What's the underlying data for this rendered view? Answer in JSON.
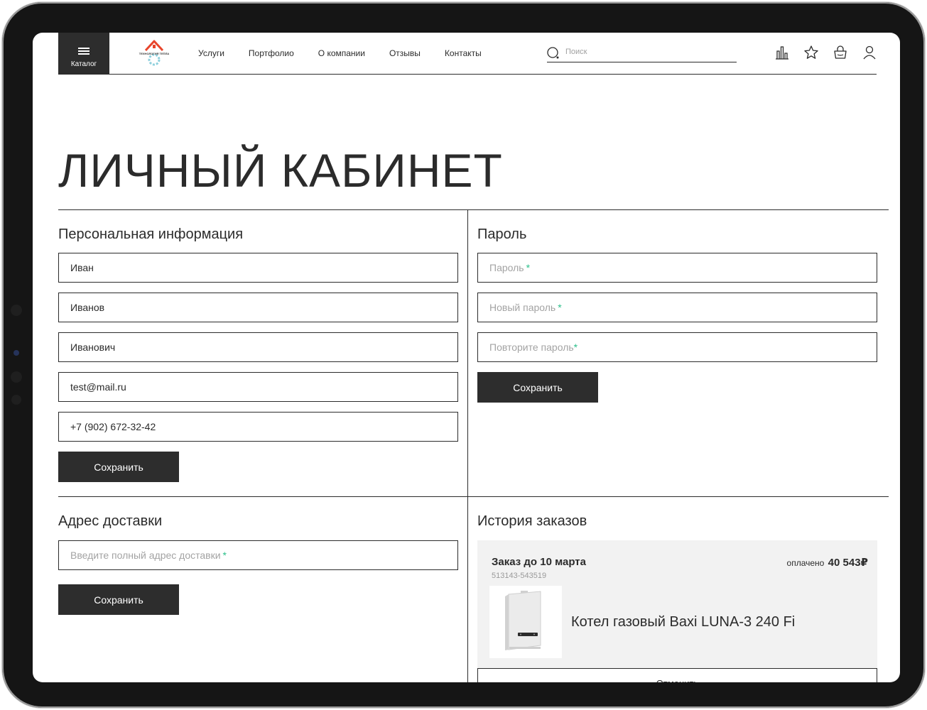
{
  "header": {
    "catalog_label": "Каталог",
    "logo_text": "ТЕХНОЛОГИЯ ТЕПЛА",
    "nav": [
      "Услуги",
      "Портфолио",
      "О компании",
      "Отзывы",
      "Контакты"
    ],
    "search_placeholder": "Поиск",
    "icons": [
      "compare-icon",
      "favorite-icon",
      "cart-icon",
      "user-icon"
    ]
  },
  "page_title": "ЛИЧНЫЙ КАБИНЕТ",
  "personal": {
    "title": "Персональная информация",
    "first_name": "Иван",
    "last_name": "Иванов",
    "middle_name": "Иванович",
    "email": "test@mail.ru",
    "phone": "+7 (902) 672-32-42",
    "save_label": "Сохранить"
  },
  "password": {
    "title": "Пароль",
    "current_placeholder": "Пароль",
    "new_placeholder": "Новый пароль",
    "repeat_placeholder": "Повторите пароль",
    "required_mark": "*",
    "save_label": "Сохранить"
  },
  "address": {
    "title": "Адрес доставки",
    "placeholder": "Введите полный адрес доставки",
    "required_mark": "*",
    "save_label": "Сохранить"
  },
  "orders": {
    "title": "История заказов",
    "items": [
      {
        "title": "Заказ до 10 марта",
        "number": "513143-543519",
        "status": "оплачено",
        "amount": "40 543₽",
        "product": "Котел газовый Baxi LUNA-3 240 Fi"
      }
    ],
    "cancel_label": "Отменить"
  },
  "colors": {
    "dark": "#2d2d2d",
    "required": "#2bbf8a",
    "card_bg": "#f2f2f2",
    "logo_accent": "#e8452c"
  }
}
